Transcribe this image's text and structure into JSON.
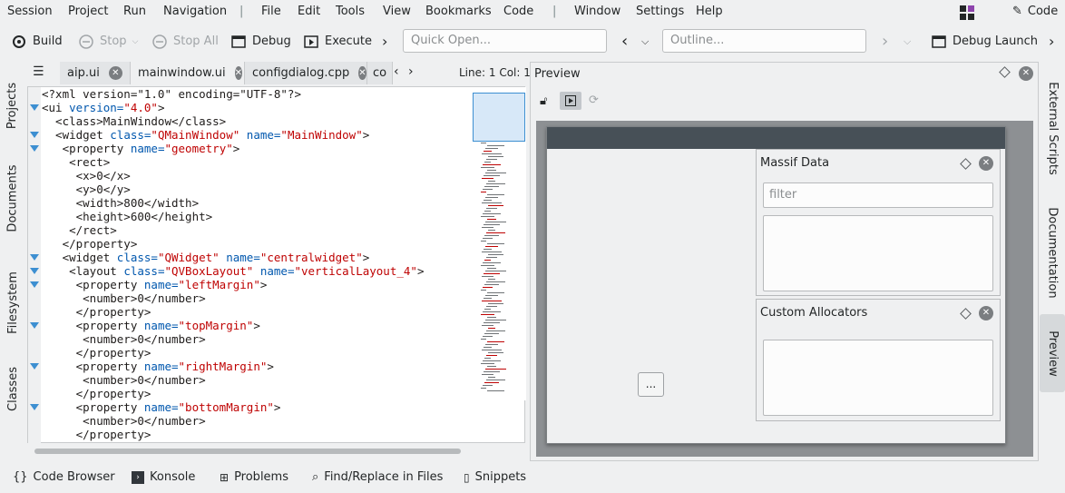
{
  "menubar": {
    "items": [
      "Session",
      "Project",
      "Run",
      "Navigation",
      "File",
      "Edit",
      "Tools",
      "View",
      "Bookmarks",
      "Code",
      "Window",
      "Settings",
      "Help"
    ],
    "area_label": "Code"
  },
  "toolbar": {
    "build": "Build",
    "stop": "Stop",
    "stop_all": "Stop All",
    "debug": "Debug",
    "execute": "Execute",
    "quick_open_placeholder": "Quick Open...",
    "outline_placeholder": "Outline...",
    "debug_launch": "Debug Launch"
  },
  "left_tools": [
    "Projects",
    "Documents",
    "Filesystem",
    "Classes"
  ],
  "right_tools": [
    "External Scripts",
    "Documentation",
    "Preview"
  ],
  "tabs": [
    "aip.ui",
    "mainwindow.ui",
    "configdialog.cpp",
    "co"
  ],
  "cursor_pos": "Line: 1 Col: 1",
  "code_lines": [
    [
      [
        "",
        "<?xml version=\"1.0\" encoding=\"UTF-8\"?>"
      ]
    ],
    [
      [
        "",
        "<ui "
      ],
      [
        "kw",
        "version="
      ],
      [
        "st",
        "\"4.0\""
      ],
      [
        "",
        ">"
      ]
    ],
    [
      [
        "",
        "  <class>MainWindow</class>"
      ]
    ],
    [
      [
        "",
        "  <widget "
      ],
      [
        "kw",
        "class="
      ],
      [
        "st",
        "\"QMainWindow\""
      ],
      [
        "kw",
        " name="
      ],
      [
        "st",
        "\"MainWindow\""
      ],
      [
        "",
        ">"
      ]
    ],
    [
      [
        "",
        "   <property "
      ],
      [
        "kw",
        "name="
      ],
      [
        "st",
        "\"geometry\""
      ],
      [
        "",
        ">"
      ]
    ],
    [
      [
        "",
        "    <rect>"
      ]
    ],
    [
      [
        "",
        "     <x>0</x>"
      ]
    ],
    [
      [
        "",
        "     <y>0</y>"
      ]
    ],
    [
      [
        "",
        "     <width>800</width>"
      ]
    ],
    [
      [
        "",
        "     <height>600</height>"
      ]
    ],
    [
      [
        "",
        "    </rect>"
      ]
    ],
    [
      [
        "",
        "   </property>"
      ]
    ],
    [
      [
        "",
        "   <widget "
      ],
      [
        "kw",
        "class="
      ],
      [
        "st",
        "\"QWidget\""
      ],
      [
        "kw",
        " name="
      ],
      [
        "st",
        "\"centralwidget\""
      ],
      [
        "",
        ">"
      ]
    ],
    [
      [
        "",
        "    <layout "
      ],
      [
        "kw",
        "class="
      ],
      [
        "st",
        "\"QVBoxLayout\""
      ],
      [
        "kw",
        " name="
      ],
      [
        "st",
        "\"verticalLayout_4\""
      ],
      [
        "",
        ">"
      ]
    ],
    [
      [
        "",
        "     <property "
      ],
      [
        "kw",
        "name="
      ],
      [
        "st",
        "\"leftMargin\""
      ],
      [
        "",
        ">"
      ]
    ],
    [
      [
        "",
        "      <number>0</number>"
      ]
    ],
    [
      [
        "",
        "     </property>"
      ]
    ],
    [
      [
        "",
        "     <property "
      ],
      [
        "kw",
        "name="
      ],
      [
        "st",
        "\"topMargin\""
      ],
      [
        "",
        ">"
      ]
    ],
    [
      [
        "",
        "      <number>0</number>"
      ]
    ],
    [
      [
        "",
        "     </property>"
      ]
    ],
    [
      [
        "",
        "     <property "
      ],
      [
        "kw",
        "name="
      ],
      [
        "st",
        "\"rightMargin\""
      ],
      [
        "",
        ">"
      ]
    ],
    [
      [
        "",
        "      <number>0</number>"
      ]
    ],
    [
      [
        "",
        "     </property>"
      ]
    ],
    [
      [
        "",
        "     <property "
      ],
      [
        "kw",
        "name="
      ],
      [
        "st",
        "\"bottomMargin\""
      ],
      [
        "",
        ">"
      ]
    ],
    [
      [
        "",
        "      <number>0</number>"
      ]
    ],
    [
      [
        "",
        "     </property>"
      ]
    ]
  ],
  "preview": {
    "title": "Preview",
    "massif_title": "Massif Data",
    "filter_placeholder": "filter",
    "allocators_title": "Custom Allocators",
    "ellipsis": "..."
  },
  "statusbar": [
    "Code Browser",
    "Konsole",
    "Problems",
    "Find/Replace in Files",
    "Snippets"
  ],
  "colors": {
    "accent": "#3d8fd1",
    "keyword": "#0057ae",
    "string": "#bf0303"
  }
}
